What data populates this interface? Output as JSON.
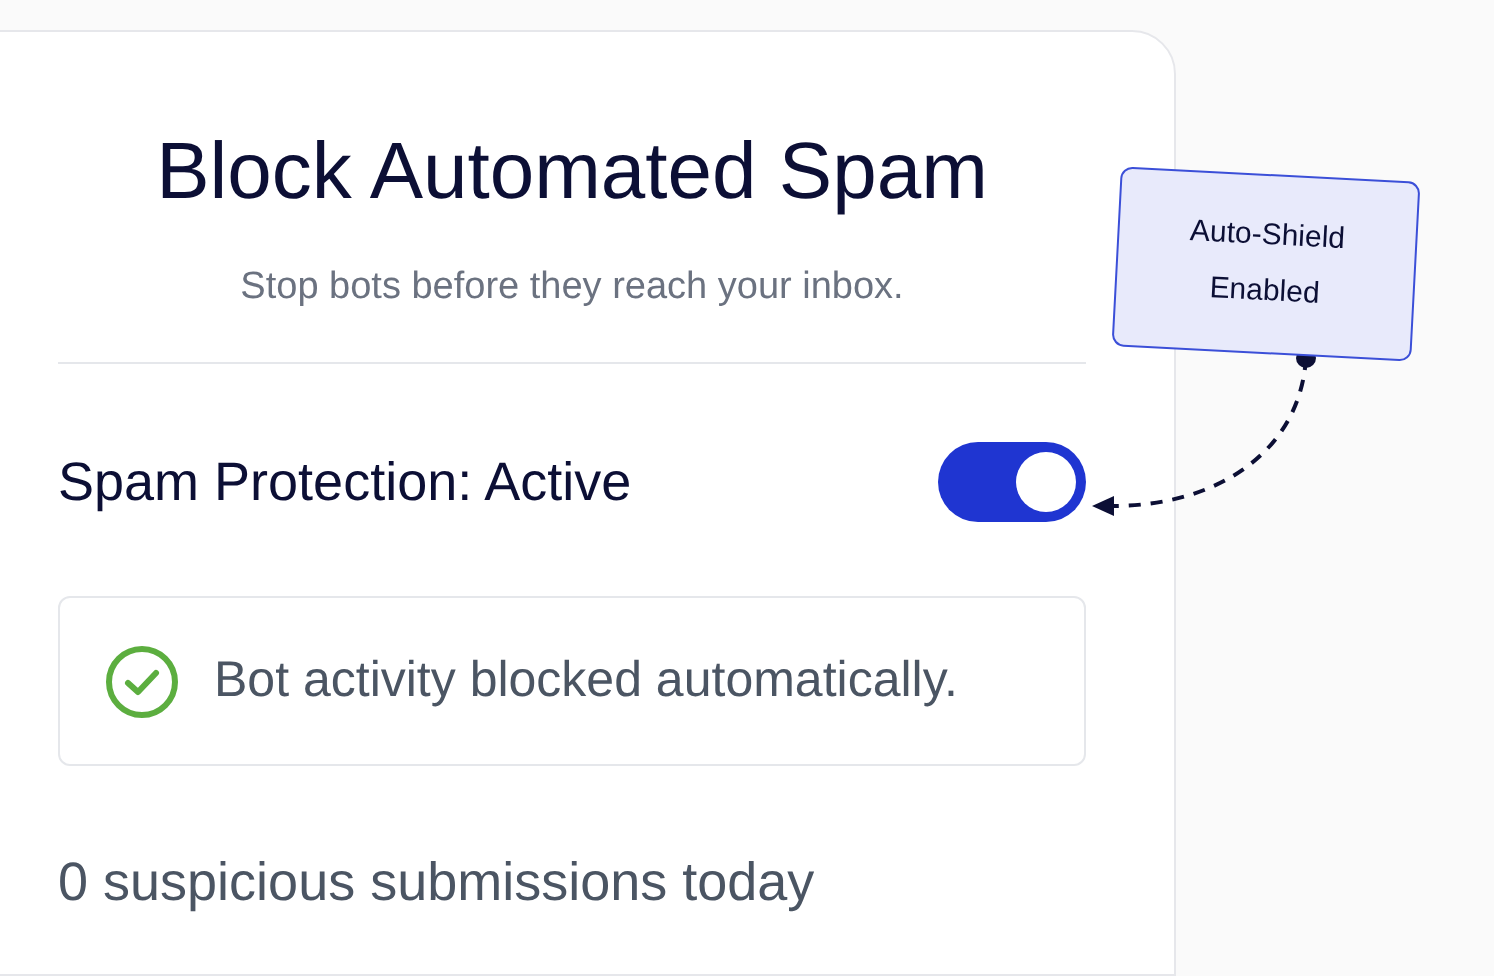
{
  "card": {
    "title": "Block Automated Spam",
    "subtitle": "Stop bots before they reach your inbox.",
    "toggle": {
      "label": "Spam Protection: Active",
      "on": true
    },
    "alert": {
      "kind": "success",
      "text": "Bot activity blocked automatically."
    },
    "stat": "0 suspicious submissions today"
  },
  "callout": {
    "text": "Auto-Shield Enabled"
  }
}
